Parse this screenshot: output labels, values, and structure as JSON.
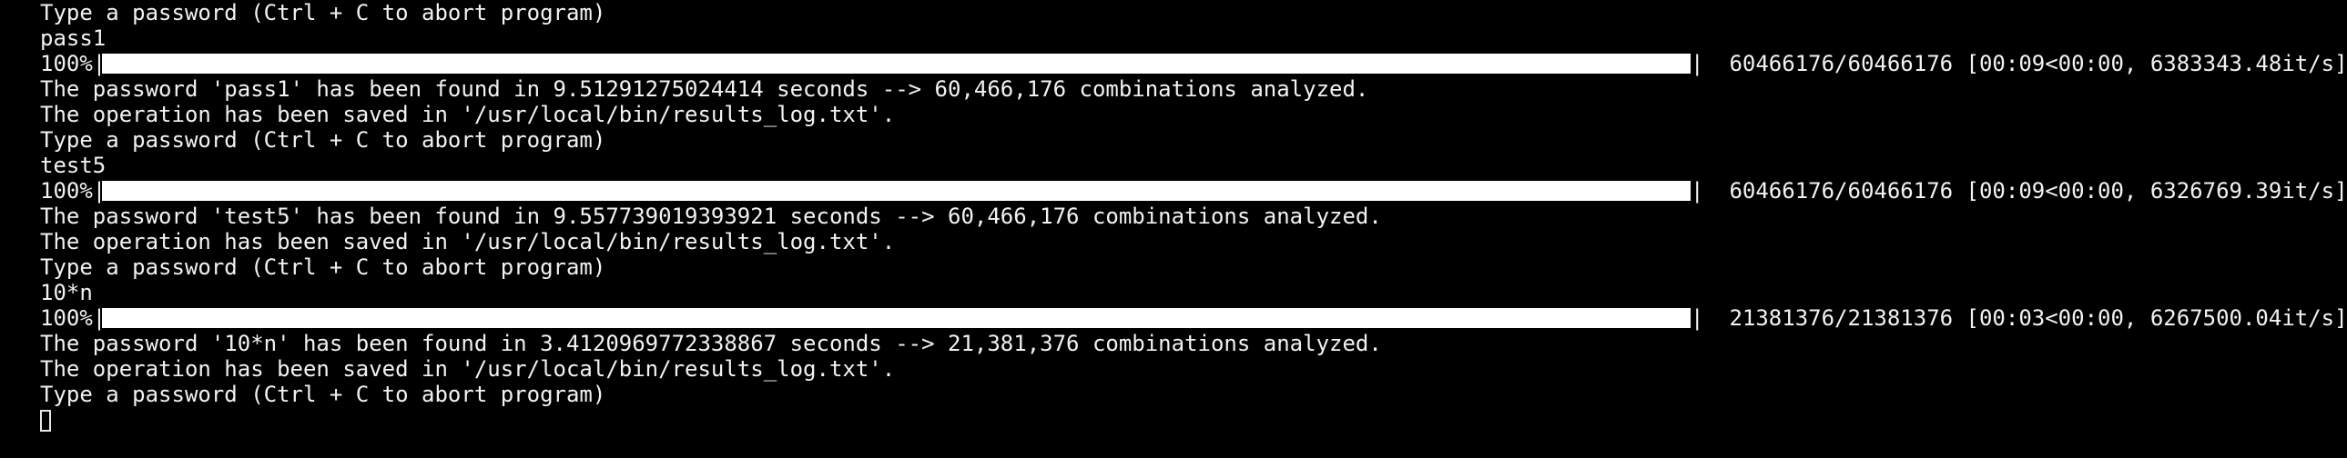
{
  "terminal": {
    "lines": [
      {
        "kind": "text",
        "text": "Type a password (Ctrl + C to abort program)"
      },
      {
        "kind": "text",
        "text": "pass1"
      },
      {
        "kind": "progress",
        "percent_label": "100%|",
        "progress": 1.0,
        "bar_end": "|",
        "stats": " 60466176/60466176 [00:09<00:00, 6383343.48it/s]"
      },
      {
        "kind": "text",
        "text": "The password 'pass1' has been found in 9.51291275024414 seconds --> 60,466,176 combinations analyzed."
      },
      {
        "kind": "text",
        "text": "The operation has been saved in '/usr/local/bin/results_log.txt'."
      },
      {
        "kind": "text",
        "text": "Type a password (Ctrl + C to abort program)"
      },
      {
        "kind": "text",
        "text": "test5"
      },
      {
        "kind": "progress",
        "percent_label": "100%|",
        "progress": 1.0,
        "bar_end": "|",
        "stats": " 60466176/60466176 [00:09<00:00, 6326769.39it/s]"
      },
      {
        "kind": "text",
        "text": "The password 'test5' has been found in 9.557739019393921 seconds --> 60,466,176 combinations analyzed."
      },
      {
        "kind": "text",
        "text": "The operation has been saved in '/usr/local/bin/results_log.txt'."
      },
      {
        "kind": "text",
        "text": "Type a password (Ctrl + C to abort program)"
      },
      {
        "kind": "text",
        "text": "10*n"
      },
      {
        "kind": "progress",
        "percent_label": "100%|",
        "progress": 1.0,
        "bar_end": "|",
        "stats": " 21381376/21381376 [00:03<00:00, 6267500.04it/s]"
      },
      {
        "kind": "text",
        "text": "The password '10*n' has been found in 3.4120969772338867 seconds --> 21,381,376 combinations analyzed."
      },
      {
        "kind": "text",
        "text": "The operation has been saved in '/usr/local/bin/results_log.txt'."
      },
      {
        "kind": "text",
        "text": "Type a password (Ctrl + C to abort program)"
      }
    ]
  },
  "colors": {
    "background": "#000000",
    "foreground": "#f2f2f2",
    "bar_fill": "#ffffff"
  }
}
